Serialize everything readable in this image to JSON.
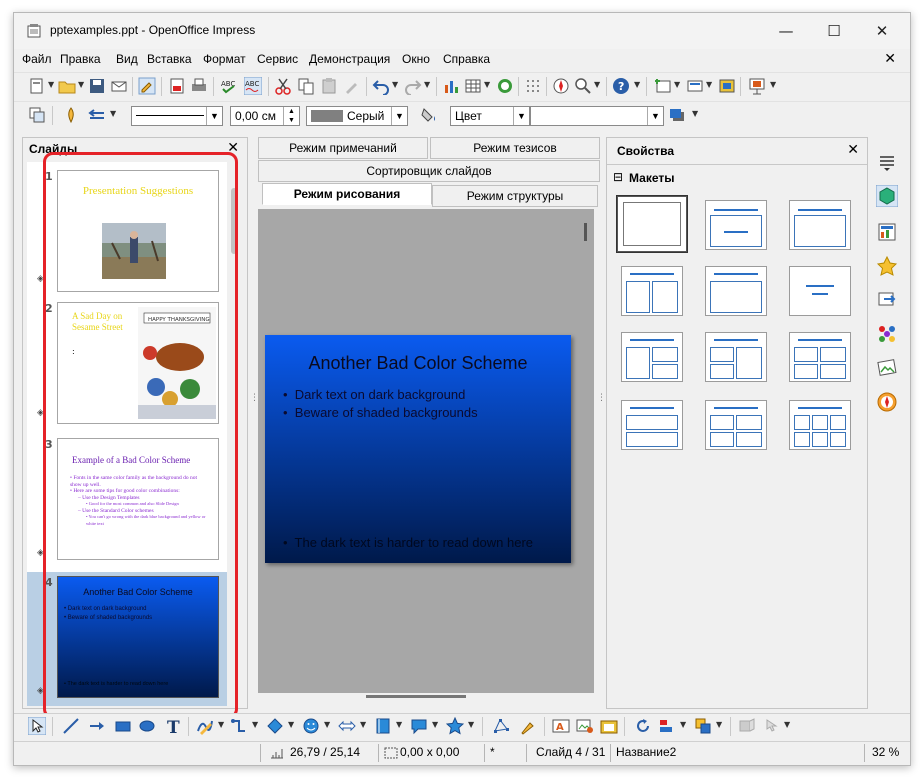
{
  "window": {
    "title": "pptexamples.ppt - OpenOffice Impress",
    "minimize": "—",
    "maximize": "☐",
    "close": "✕"
  },
  "menu": {
    "items": [
      "Файл",
      "Правка",
      "Вид",
      "Вставка",
      "Формат",
      "Сервис",
      "Демонстрация",
      "Окно",
      "Справка"
    ],
    "close_doc": "✕"
  },
  "line_toolbar": {
    "width_value": "0,00 см",
    "area_color": "Серый",
    "fill_type": "Цвет"
  },
  "slides_panel": {
    "title": "Слайды",
    "close": "✕",
    "slides": [
      {
        "number": "1",
        "title": "Presentation Suggestions"
      },
      {
        "number": "2",
        "title": "A Sad Day on Sesame Street",
        "caption": "HAPPY THANKSGIVING"
      },
      {
        "number": "3",
        "title": "Example of a Bad Color Scheme",
        "bullets": [
          "Fonts in the same color family as the background do not show up well.",
          "Here are some tips for good color combinations:"
        ],
        "subbullets": [
          "Use the Design Templates",
          "Use the Standard Color schemes"
        ],
        "subsub": [
          "Good for the most common and also Slide Design",
          "You can't go wrong with the dark blue background and yellow or white text"
        ]
      },
      {
        "number": "4",
        "title": "Another Bad Color Scheme",
        "bullets": [
          "Dark text on dark background",
          "Beware of shaded backgrounds"
        ],
        "footer": "The dark text is harder to read down here"
      }
    ]
  },
  "view_tabs": {
    "row1": [
      "Режим примечаний",
      "Режим тезисов"
    ],
    "row2": [
      "Сортировщик слайдов"
    ],
    "row3": [
      "Режим рисования",
      "Режим структуры"
    ]
  },
  "main_slide": {
    "title": "Another Bad Color Scheme",
    "bullets": [
      "Dark text on dark background",
      "Beware of shaded backgrounds"
    ],
    "footer": "The dark text is harder to read down here"
  },
  "properties_panel": {
    "title": "Свойства",
    "close": "✕",
    "section": "Макеты",
    "collapse": "⊟"
  },
  "status": {
    "position": "26,79 / 25,14",
    "size": "0,00 x 0,00",
    "modified": "*",
    "slide": "Слайд 4 / 31",
    "layout_name": "Название2",
    "zoom": "32 %"
  },
  "colors": {
    "selection_highlight": "#e52228",
    "slide_gradient_top": "#0a5bf0",
    "slide_gradient_bottom": "#00194a",
    "title3_color": "#6a1fb0",
    "title1_color": "#e8d61a"
  }
}
